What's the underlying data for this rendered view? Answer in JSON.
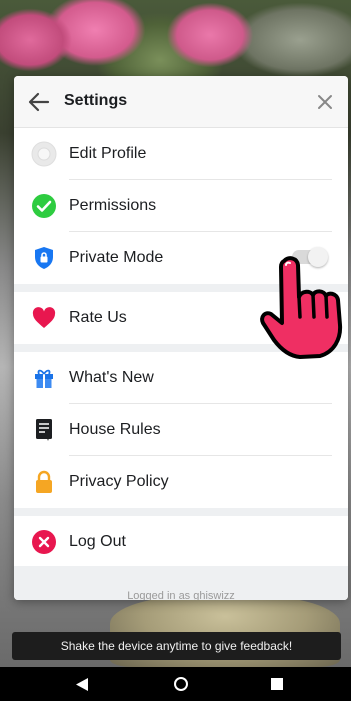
{
  "header": {
    "title": "Settings"
  },
  "sections": [
    [
      {
        "label": "Edit Profile",
        "icon": "avatar-icon"
      },
      {
        "label": "Permissions",
        "icon": "check-circle-icon"
      },
      {
        "label": "Private Mode",
        "icon": "shield-icon",
        "toggle": false
      }
    ],
    [
      {
        "label": "Rate Us",
        "icon": "heart-icon"
      }
    ],
    [
      {
        "label": "What's New",
        "icon": "gift-icon"
      },
      {
        "label": "House Rules",
        "icon": "rules-doc-icon"
      },
      {
        "label": "Privacy Policy",
        "icon": "lock-icon"
      }
    ],
    [
      {
        "label": "Log Out",
        "icon": "logout-icon"
      }
    ]
  ],
  "footer": {
    "logged_in_text": "Logged in as ghiswizz"
  },
  "snackbar": {
    "text": "Shake the device anytime to give feedback!"
  },
  "colors": {
    "permissions_green": "#2ecc40",
    "shield_blue": "#1877f2",
    "heart_red": "#e8174f",
    "gift_blue": "#1a73e8",
    "lock_orange": "#f5a623",
    "logout_red": "#e8174f"
  }
}
